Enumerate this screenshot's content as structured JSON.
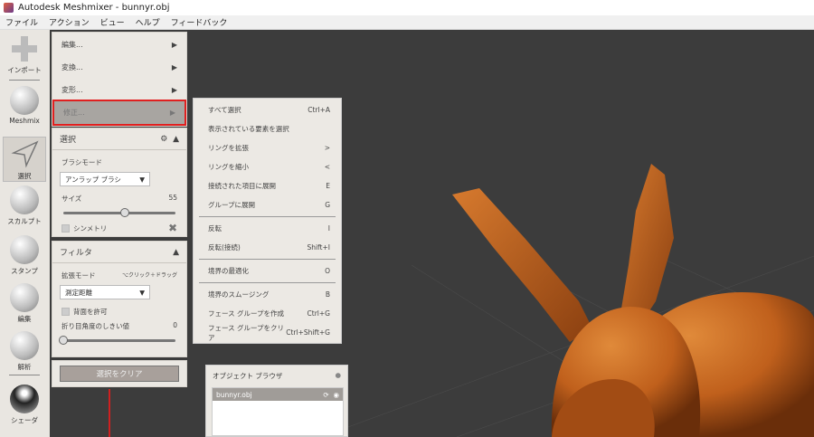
{
  "window": {
    "title": "Autodesk Meshmixer - bunnyr.obj"
  },
  "menubar": [
    "ファイル",
    "アクション",
    "ビュー",
    "ヘルプ",
    "フィードバック"
  ],
  "toolbar": [
    {
      "label": "インポート",
      "icon": "plus-icon"
    },
    {
      "label": "Meshmix",
      "icon": "meshmix-head-icon"
    },
    {
      "label": "選択",
      "icon": "select-arrow-icon"
    },
    {
      "label": "スカルプト",
      "icon": "sculpt-brush-icon"
    },
    {
      "label": "スタンプ",
      "icon": "stamp-icon"
    },
    {
      "label": "編集",
      "icon": "edit-mesh-icon"
    },
    {
      "label": "解析",
      "icon": "analysis-icon"
    },
    {
      "label": "シェーダ",
      "icon": "shader-sphere-icon"
    }
  ],
  "submenu": [
    {
      "label": "編集...",
      "arrow": "▶"
    },
    {
      "label": "変換...",
      "arrow": "▶"
    },
    {
      "label": "変形...",
      "arrow": "▶"
    },
    {
      "label": "修正...",
      "arrow": "▶"
    }
  ],
  "select_panel": {
    "title": "選択",
    "brush_mode_label": "ブラシモード",
    "brush_mode_value": "アンラップ ブラシ",
    "size_label": "サイズ",
    "size_value": "55",
    "size_fraction": 0.55,
    "symmetry_label": "シンメトリ"
  },
  "filter_panel": {
    "title": "フィルタ",
    "expand_mode_label": "拡張モード",
    "expand_hint": "⌥クリック＋ドラッグ",
    "expand_mode_value": "測定距離",
    "allow_backface_label": "背面を許可",
    "crease_label": "折り目角度のしきい値",
    "crease_value": "0",
    "crease_fraction": 0
  },
  "clear_button": "選択をクリア",
  "context_menu": [
    [
      {
        "label": "すべて選択",
        "shortcut": "Ctrl+A"
      },
      {
        "label": "表示されている要素を選択",
        "shortcut": ""
      },
      {
        "label": "リングを拡張",
        "shortcut": ">"
      },
      {
        "label": "リングを縮小",
        "shortcut": "<"
      },
      {
        "label": "接続された項目に展開",
        "shortcut": "E"
      },
      {
        "label": "グループに展開",
        "shortcut": "G"
      }
    ],
    [
      {
        "label": "反転",
        "shortcut": "I"
      },
      {
        "label": "反転(接続)",
        "shortcut": "Shift+I"
      }
    ],
    [
      {
        "label": "境界の最適化",
        "shortcut": "O"
      }
    ],
    [
      {
        "label": "境界のスムージング",
        "shortcut": "B"
      },
      {
        "label": "フェース グループを作成",
        "shortcut": "Ctrl+G"
      },
      {
        "label": "フェース グループをクリア",
        "shortcut": "Ctrl+Shift+G"
      }
    ]
  ],
  "object_browser": {
    "title": "オブジェクト ブラウザ",
    "items": [
      {
        "name": "bunnyr.obj"
      }
    ]
  },
  "colors": {
    "mesh": "#c8661f",
    "highlight_outline": "#e02020",
    "viewport": "#3c3c3c"
  }
}
